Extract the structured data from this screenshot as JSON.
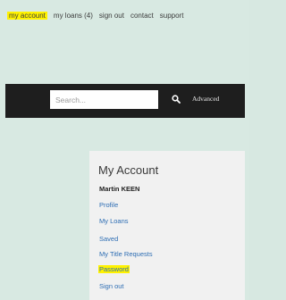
{
  "topnav": {
    "items": [
      "my account",
      "my loans (4)",
      "sign out",
      "contact",
      "support"
    ]
  },
  "search": {
    "placeholder": "Search...",
    "advanced_label": "Advanced"
  },
  "account": {
    "title": "My Account",
    "user": "Martin KEEN",
    "links": [
      "Profile",
      "My Loans",
      "Saved",
      "My Title Requests",
      "Password",
      "Sign out"
    ]
  },
  "colors": {
    "highlight": "#fff200",
    "link": "#2d6db3",
    "bar": "#1e1e1e",
    "background": "#d8e9e2"
  }
}
